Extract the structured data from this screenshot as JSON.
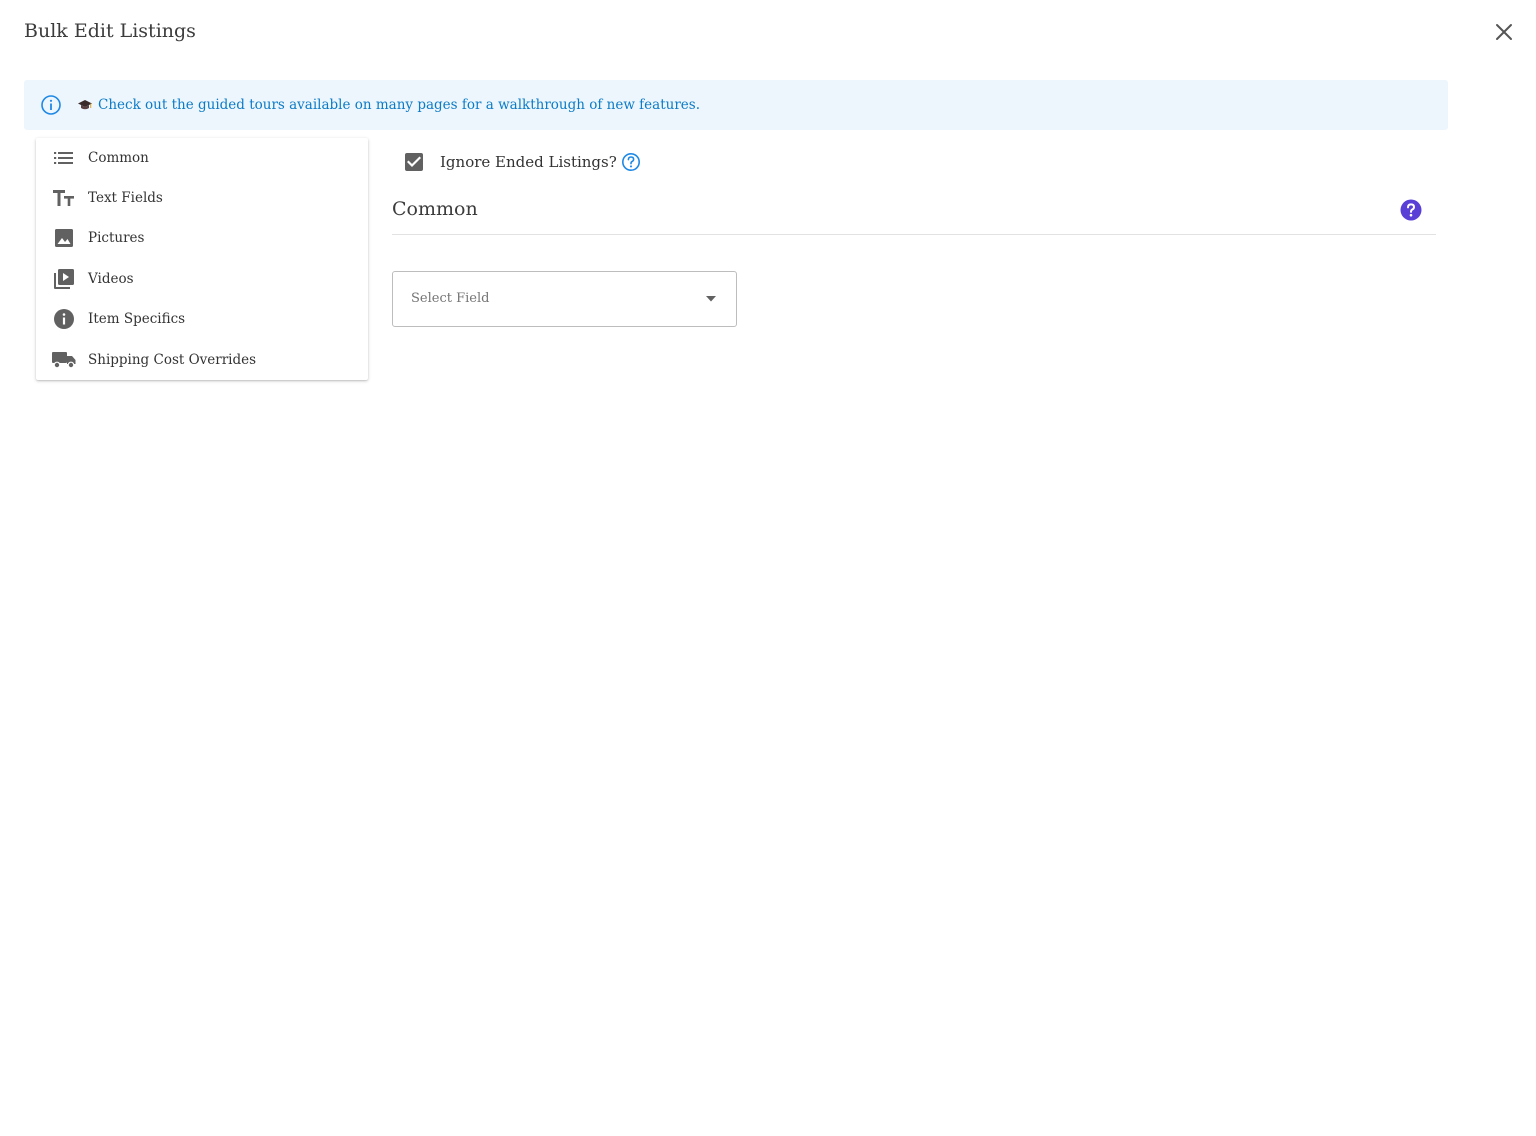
{
  "dialog": {
    "title": "Bulk Edit Listings",
    "close_icon": "close-icon"
  },
  "banner": {
    "icon": "info-outline-icon",
    "emoji": "🎓",
    "text": "Check out the guided tours available on many pages for a walkthrough of new features.",
    "text_color": "#0b7bc6",
    "background": "#eef6fd"
  },
  "nav": {
    "items": [
      {
        "label": "Common",
        "icon": "list-icon"
      },
      {
        "label": "Text Fields",
        "icon": "text-fields-icon"
      },
      {
        "label": "Pictures",
        "icon": "image-icon"
      },
      {
        "label": "Videos",
        "icon": "video-library-icon"
      },
      {
        "label": "Item Specifics",
        "icon": "info-filled-icon"
      },
      {
        "label": "Shipping Cost Overrides",
        "icon": "truck-icon"
      }
    ]
  },
  "options": {
    "ignore_ended_label": "Ignore Ended Listings?",
    "ignore_ended_checked": true
  },
  "section": {
    "title": "Common",
    "help_icon": "help-circle-icon",
    "help_color": "#5a3fd6"
  },
  "select": {
    "placeholder": "Select Field",
    "caret_icon": "caret-down-icon"
  }
}
